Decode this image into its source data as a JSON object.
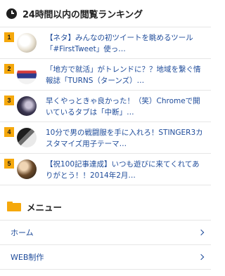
{
  "ranking": {
    "title": "24時間以内の閲覧ランキング",
    "items": [
      {
        "rank": "1",
        "title": "【ネタ】みんなの初ツイートを眺めるツール「#FirstTweet」使っ…"
      },
      {
        "rank": "2",
        "title": "「地方で就活」がトレンドに？？地域を繋ぐ情報誌「TURNS（ターンズ）…"
      },
      {
        "rank": "3",
        "title": "早くやっときゃ良かった！（笑）Chromeで開いているタブは「中断」…"
      },
      {
        "rank": "4",
        "title": "10分で男の戦闘服を手に入れろ！STINGER3カスタマイズ用子テーマ…"
      },
      {
        "rank": "5",
        "title": "【祝100記事達成】いつも遊びに来てくれてありがとう！！2014年2月…"
      }
    ]
  },
  "menu": {
    "title": "メニュー",
    "items": [
      {
        "label": "ホーム"
      },
      {
        "label": "WEB制作"
      }
    ]
  }
}
